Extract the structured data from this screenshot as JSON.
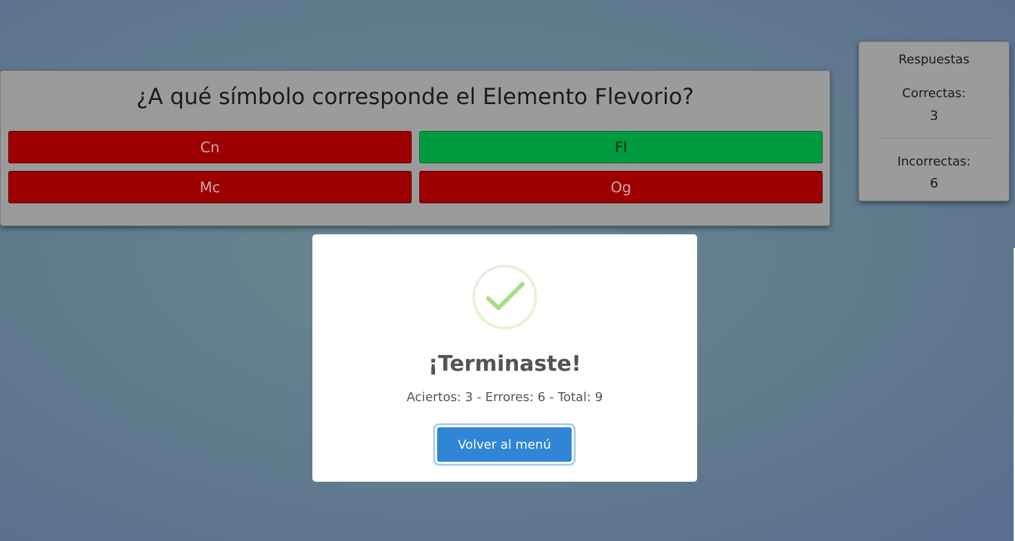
{
  "question": {
    "title": "¿A qué símbolo corresponde el Elemento Flevorio?",
    "options": [
      {
        "label": "Cn",
        "state": "wrong"
      },
      {
        "label": "Fl",
        "state": "correct"
      },
      {
        "label": "Mc",
        "state": "wrong"
      },
      {
        "label": "Og",
        "state": "wrong"
      }
    ]
  },
  "score_panel": {
    "title": "Respuestas",
    "correct_label": "Correctas:",
    "correct_value": "3",
    "incorrect_label": "Incorrectas:",
    "incorrect_value": "6"
  },
  "modal": {
    "icon": "success-check-icon",
    "title": "¡Terminaste!",
    "summary": "Aciertos: 3 - Errores: 6 - Total: 9",
    "button_label": "Volver al menú"
  },
  "colors": {
    "wrong": "#9d0000",
    "correct": "#009a3f",
    "button": "#3085d6",
    "success_icon": "#a5dc86"
  }
}
